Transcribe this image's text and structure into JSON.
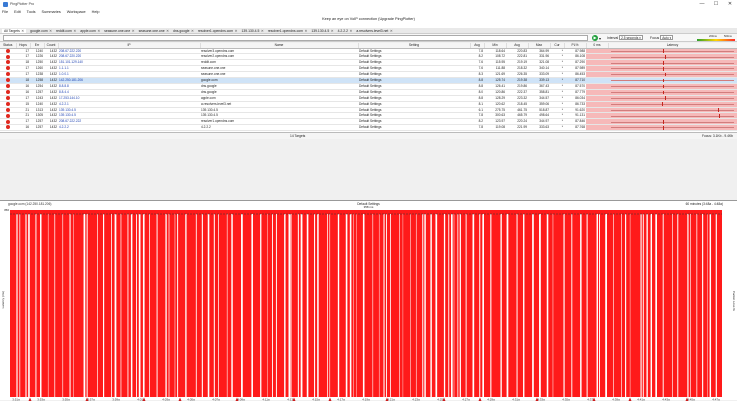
{
  "window": {
    "title": "PingPlotter Pro",
    "minimize": "—",
    "maximize": "☐",
    "close": "✕"
  },
  "menu": [
    "File",
    "Edit",
    "Tools",
    "Summaries",
    "Workspace",
    "Help"
  ],
  "banner": {
    "line1": "Keep an eye on VoIP connection (Upgrade PingPlotter)",
    "link": "Upgrade PingPlotter"
  },
  "tabs": [
    {
      "label": "All Targets",
      "active": true
    },
    {
      "label": "google.com",
      "active": false
    },
    {
      "label": "reddit.com",
      "active": false
    },
    {
      "label": "apple.com",
      "active": false
    },
    {
      "label": "seasune.one.one",
      "active": false
    },
    {
      "label": "seasune.one.one",
      "active": false
    },
    {
      "label": "dns.google",
      "active": false
    },
    {
      "label": "resolver1.opendns.com",
      "active": false
    },
    {
      "label": "139.130.4.5",
      "active": false
    },
    {
      "label": "resolver1.opendns.com",
      "active": false
    },
    {
      "label": "139.130.4.5",
      "active": false
    },
    {
      "label": "4.2.2.2",
      "active": false
    },
    {
      "label": "a.resolvers.level3.net",
      "active": false
    }
  ],
  "toolbar": {
    "interval_label": "Interval",
    "interval_value": "2.5 seconds",
    "focus_label": "Focus",
    "focus_value": "Auto",
    "legend_low": "200ms",
    "legend_high": "500ms",
    "legend_mid": "100ms"
  },
  "table": {
    "headers": [
      "Status",
      "Hops",
      "Err",
      "Count",
      "IP",
      "Name",
      "Setting",
      "Avg",
      "Min",
      "Avg",
      "Max",
      "Cur",
      "PL%",
      "0 ms",
      "Latency"
    ],
    "rows": [
      {
        "hops": "17",
        "err": "1240",
        "count": "1432",
        "ip": "208.67.222.220",
        "name": "resolver3.opendns.com",
        "setting": "Default Settings",
        "avg": "7.8",
        "min": "118.64",
        "avg2": "220.83",
        "max": "364.99",
        "cur": "*",
        "pl": "87.988",
        "mark": 0.43
      },
      {
        "hops": "17",
        "err": "1226",
        "count": "1432",
        "ip": "208.67.220.220",
        "name": "resolver2.opendns.com",
        "setting": "Default Settings",
        "avg": "8.2",
        "min": "108.72",
        "avg2": "222.81",
        "max": "331.96",
        "cur": "*",
        "pl": "86.108",
        "mark": 0.44
      },
      {
        "hops": "18",
        "err": "1250",
        "count": "1432",
        "ip": "151.101.129.140",
        "name": "reddit.com",
        "setting": "Default Settings",
        "avg": "7.6",
        "min": "115.95",
        "avg2": "219.19",
        "max": "321.08",
        "cur": "*",
        "pl": "87.290",
        "mark": 0.43
      },
      {
        "hops": "17",
        "err": "1260",
        "count": "1432",
        "ip": "1.1.1.1",
        "name": "seasune.one.one",
        "setting": "Default Settings",
        "avg": "7.6",
        "min": "111.88",
        "avg2": "218.32",
        "max": "340.14",
        "cur": "*",
        "pl": "87.989",
        "mark": 0.43
      },
      {
        "hops": "17",
        "err": "1238",
        "count": "1432",
        "ip": "1.0.0.1",
        "name": "seasune.one.one",
        "setting": "Default Settings",
        "avg": "8.3",
        "min": "121.69",
        "avg2": "226.35",
        "max": "333.09",
        "cur": "*",
        "pl": "86.453",
        "mark": 0.44
      },
      {
        "hops": "18",
        "err": "1258",
        "count": "1432",
        "ip": "142.250.181.206",
        "name": "google.com",
        "setting": "Default Settings",
        "avg": "8.8",
        "min": "125.74",
        "avg2": "219.38",
        "max": "339.13",
        "cur": "*",
        "pl": "87.710",
        "mark": 0.43,
        "sel": true
      },
      {
        "hops": "16",
        "err": "1254",
        "count": "1432",
        "ip": "8.8.8.8",
        "name": "dns.google",
        "setting": "Default Settings",
        "avg": "8.8",
        "min": "126.41",
        "avg2": "219.86",
        "max": "367.43",
        "cur": "*",
        "pl": "87.570",
        "mark": 0.43
      },
      {
        "hops": "16",
        "err": "1257",
        "count": "1432",
        "ip": "8.8.4.4",
        "name": "dns.google",
        "setting": "Default Settings",
        "avg": "8.0",
        "min": "120.86",
        "avg2": "222.37",
        "max": "358.81",
        "cur": "*",
        "pl": "87.779",
        "mark": 0.43
      },
      {
        "hops": "17",
        "err": "1243",
        "count": "1432",
        "ip": "17.253.144.10",
        "name": "apple.com",
        "setting": "Default Settings",
        "avg": "8.8",
        "min": "128.29",
        "avg2": "223.32",
        "max": "344.57",
        "cur": "*",
        "pl": "86.034",
        "mark": 0.44
      },
      {
        "hops": "15",
        "err": "1240",
        "count": "1432",
        "ip": "4.2.2.1",
        "name": "a.resolvers.level3.net",
        "setting": "Default Settings",
        "avg": "8.1",
        "min": "120.62",
        "avg2": "218.45",
        "max": "359.06",
        "cur": "*",
        "pl": "86.733",
        "mark": 0.42
      },
      {
        "hops": "21",
        "err": "1313",
        "count": "1432",
        "ip": "139.130.4.5",
        "name": "139.130.4.5",
        "setting": "Default Settings",
        "avg": "6.1",
        "min": "275.75",
        "avg2": "461.75",
        "max": "518.87",
        "cur": "*",
        "pl": "91.620",
        "mark": 0.85
      },
      {
        "hops": "21",
        "err": "1305",
        "count": "1432",
        "ip": "139.130.4.5",
        "name": "139.130.4.5",
        "setting": "Default Settings",
        "avg": "7.8",
        "min": "300.63",
        "avg2": "465.79",
        "max": "498.64",
        "cur": "*",
        "pl": "91.131",
        "mark": 0.86
      },
      {
        "hops": "17",
        "err": "1257",
        "count": "1432",
        "ip": "208.67.222.222",
        "name": "resolver1.opendns.com",
        "setting": "Default Settings",
        "avg": "8.2",
        "min": "123.97",
        "avg2": "220.24",
        "max": "344.97",
        "cur": "*",
        "pl": "87.846",
        "mark": 0.43
      },
      {
        "hops": "16",
        "err": "1257",
        "count": "1432",
        "ip": "4.2.2.2",
        "name": "4.2.2.2",
        "setting": "Default Settings",
        "avg": "7.8",
        "min": "119.08",
        "avg2": "221.99",
        "max": "333.63",
        "cur": "*",
        "pl": "87.768",
        "mark": 0.43
      }
    ],
    "count_label": "14 Targets",
    "focus_info": "Focus: 3.1Kb - 9.4Kb"
  },
  "graph": {
    "header_left": "google.com (142.250.181.206)",
    "header_center": "Default Settings",
    "header_center2": "358 ms",
    "header_right": "60 minutes (3:48a - 4:48a)",
    "ylabel_left": "Latency (ms)",
    "ylabel_right": "Packet Loss %",
    "ytop": "350",
    "xticks": [
      "3:51a",
      "3:53a",
      "3:55a",
      "3:57a",
      "3:59a",
      "4:01a",
      "4:03a",
      "4:05a",
      "4:07a",
      "4:09a",
      "4:11a",
      "4:13a",
      "4:15a",
      "4:17a",
      "4:19a",
      "4:21a",
      "4:23a",
      "4:25a",
      "4:27a",
      "4:29a",
      "4:31a",
      "4:33a",
      "4:35a",
      "4:37a",
      "4:39a",
      "4:41a",
      "4:43a",
      "4:45a",
      "4:47a"
    ],
    "loss_color": "#ff1a1a",
    "ok_color": "#ffffff"
  }
}
